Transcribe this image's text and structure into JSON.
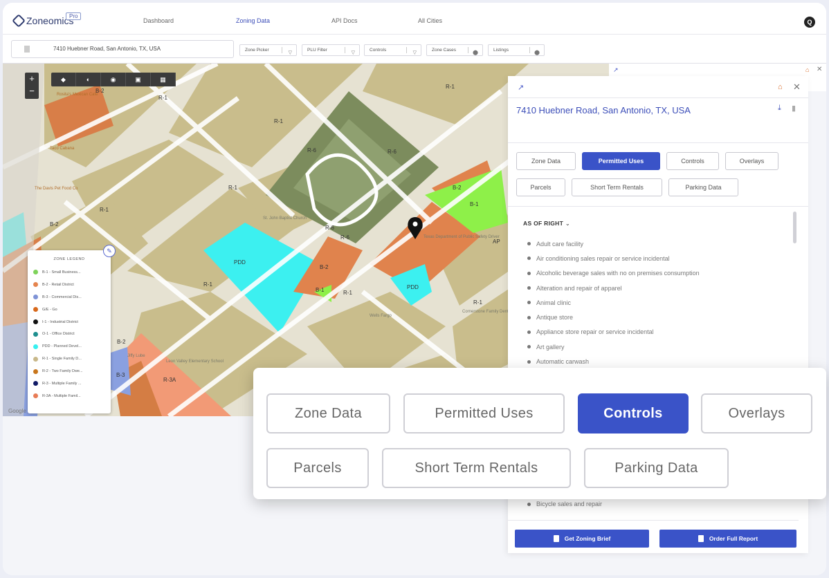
{
  "app": {
    "logo_text": "Zoneomics",
    "badge": "Pro",
    "user_initial": "Q"
  },
  "nav": {
    "items": [
      {
        "label": "Dashboard"
      },
      {
        "label": "Zoning Data"
      },
      {
        "label": "API Docs"
      },
      {
        "label": "All Cities"
      }
    ],
    "active": "Zoning Data"
  },
  "search": {
    "address": "7410 Huebner Road, San Antonio, TX, USA"
  },
  "filters": [
    {
      "label": "Zone Picker",
      "icon": "filter-icon"
    },
    {
      "label": "PLU Filter",
      "icon": "filter-icon"
    },
    {
      "label": "Controls",
      "icon": "filter-icon"
    },
    {
      "label": "Zone Cases",
      "icon": "pin-icon"
    },
    {
      "label": "Listings",
      "icon": "pin-icon"
    }
  ],
  "map": {
    "zoom_in": "+",
    "zoom_out": "−",
    "attribution": "Google",
    "zone_labels": [
      "R-1",
      "R-1",
      "R-1",
      "R-1",
      "R-1",
      "R-1",
      "R-1",
      "R-1",
      "B-2",
      "B-2",
      "B-2",
      "B-2",
      "B-2",
      "B-1",
      "B-1",
      "B-3",
      "R-6",
      "R-6",
      "R-6",
      "R-6",
      "PDD",
      "PDD",
      "R-3A",
      "AP"
    ],
    "pois": [
      "Rosita's Mexican Cafe",
      "Taco Cabana",
      "The Davis Pet Food Co",
      "St. John Baptist Church",
      "Texas Department of Public Safety Driver",
      "Leon Valley Elementary School",
      "Jiffy Lube",
      "Wells Fargo",
      "Cornerstone Family Dental"
    ],
    "legend_title": "ZONE LEGEND",
    "legend": [
      {
        "label": "B-1 - Small Business...",
        "color": "#7ed35a"
      },
      {
        "label": "B-2 - Retail District",
        "color": "#e5844e"
      },
      {
        "label": "B-3 - Commercial Dis...",
        "color": "#7f93d6"
      },
      {
        "label": "G/E - Go",
        "color": "#d8691c"
      },
      {
        "label": "I-1 - Industrial District",
        "color": "#111111"
      },
      {
        "label": "O-1 - Office District",
        "color": "#1f8f8f"
      },
      {
        "label": "PDD - Planned Devel...",
        "color": "#37f0f0"
      },
      {
        "label": "R-1 - Single Family D...",
        "color": "#c8b88a"
      },
      {
        "label": "R-2 - Two Family Dwe...",
        "color": "#c8761c"
      },
      {
        "label": "R-3 - Multiple Family ...",
        "color": "#111a66"
      },
      {
        "label": "R-3A - Multiple Famil...",
        "color": "#e87c56"
      }
    ]
  },
  "panel": {
    "title": "7410 Huebner Road, San Antonio, TX, USA",
    "tabs": [
      {
        "label": "Zone Data",
        "active": false
      },
      {
        "label": "Permitted Uses",
        "active": true
      },
      {
        "label": "Controls",
        "active": false
      },
      {
        "label": "Overlays",
        "active": false
      },
      {
        "label": "Parcels",
        "active": false
      },
      {
        "label": "Short Term Rentals",
        "active": false
      },
      {
        "label": "Parking Data",
        "active": false
      }
    ],
    "section": "AS OF RIGHT",
    "uses": [
      "Adult care facility",
      "Air conditioning sales repair or service incidental",
      "Alcoholic beverage sales with no on premises consumption",
      "Alteration and repair of apparel",
      "Animal clinic",
      "Antique store",
      "Appliance store repair or service incidental",
      "Art gallery",
      "Automatic carwash"
    ],
    "partial_use": "Bicycle sales and repair",
    "buttons": {
      "brief": "Get Zoning Brief",
      "report": "Order Full Report"
    }
  },
  "zoom_callout": {
    "tabs": [
      {
        "label": "Zone Data",
        "active": false
      },
      {
        "label": "Permitted Uses",
        "active": false
      },
      {
        "label": "Controls",
        "active": true
      },
      {
        "label": "Overlays",
        "active": false
      },
      {
        "label": "Parcels",
        "active": false
      },
      {
        "label": "Short Term Rentals",
        "active": false
      },
      {
        "label": "Parking Data",
        "active": false
      }
    ]
  }
}
